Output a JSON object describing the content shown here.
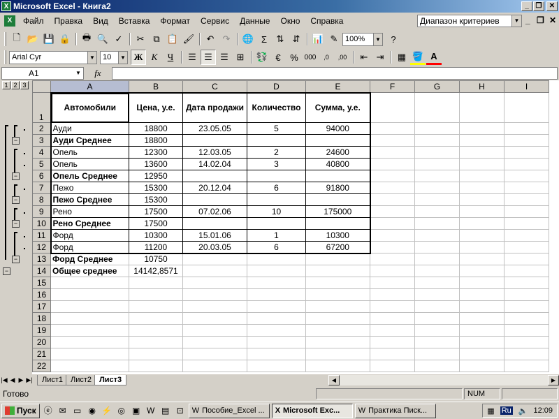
{
  "window": {
    "title": "Microsoft Excel - Книга2",
    "app_icon": "X"
  },
  "menu": {
    "items": [
      "Файл",
      "Правка",
      "Вид",
      "Вставка",
      "Формат",
      "Сервис",
      "Данные",
      "Окно",
      "Справка"
    ],
    "help_box": "Диапазон критериев"
  },
  "toolbar": {
    "zoom": "100%",
    "font_name": "Arial Cyr",
    "font_size": "10",
    "bold_label": "Ж",
    "italic_label": "К",
    "underline_label": "Ч"
  },
  "formula": {
    "name_box": "A1",
    "fx": "fx",
    "content": ""
  },
  "grid": {
    "columns": [
      "A",
      "B",
      "C",
      "D",
      "E",
      "F",
      "G",
      "H",
      "I"
    ],
    "header_row": [
      "Автомобили",
      "Цена, у.е.",
      "Дата продажи",
      "Количество",
      "Сумма, у.е."
    ],
    "rows": [
      {
        "n": "2",
        "cells": [
          "Ауди",
          "18800",
          "23.05.05",
          "5",
          "94000"
        ],
        "bold": false
      },
      {
        "n": "3",
        "cells": [
          "Ауди Среднее",
          "18800",
          "",
          "",
          ""
        ],
        "bold": true
      },
      {
        "n": "4",
        "cells": [
          "Опель",
          "12300",
          "12.03.05",
          "2",
          "24600"
        ],
        "bold": false
      },
      {
        "n": "5",
        "cells": [
          "Опель",
          "13600",
          "14.02.04",
          "3",
          "40800"
        ],
        "bold": false
      },
      {
        "n": "6",
        "cells": [
          "Опель Среднее",
          "12950",
          "",
          "",
          ""
        ],
        "bold": true
      },
      {
        "n": "7",
        "cells": [
          "Пежо",
          "15300",
          "20.12.04",
          "6",
          "91800"
        ],
        "bold": false
      },
      {
        "n": "8",
        "cells": [
          "Пежо Среднее",
          "15300",
          "",
          "",
          ""
        ],
        "bold": true
      },
      {
        "n": "9",
        "cells": [
          "Рено",
          "17500",
          "07.02.06",
          "10",
          "175000"
        ],
        "bold": false
      },
      {
        "n": "10",
        "cells": [
          "Рено Среднее",
          "17500",
          "",
          "",
          ""
        ],
        "bold": true
      },
      {
        "n": "11",
        "cells": [
          "Форд",
          "10300",
          "15.01.06",
          "1",
          "10300"
        ],
        "bold": false
      },
      {
        "n": "12",
        "cells": [
          "Форд",
          "11200",
          "20.03.05",
          "6",
          "67200"
        ],
        "bold": false
      },
      {
        "n": "13",
        "cells": [
          "Форд Среднее",
          "10750",
          "",
          "",
          ""
        ],
        "bold": true
      },
      {
        "n": "14",
        "cells": [
          "Общее среднее",
          "14142,8571",
          "",
          "",
          ""
        ],
        "bold": true
      }
    ],
    "empty_rows": [
      "15",
      "16",
      "17",
      "18",
      "19",
      "20",
      "21",
      "22"
    ]
  },
  "outline": {
    "levels": [
      "1",
      "2",
      "3"
    ]
  },
  "sheets": {
    "tabs": [
      "Лист1",
      "Лист2",
      "Лист3"
    ],
    "active": "Лист3"
  },
  "status": {
    "text": "Готово",
    "num": "NUM"
  },
  "taskbar": {
    "start": "Пуск",
    "tasks": [
      "Пособие_Excel ...",
      "Microsoft Exc...",
      "Практика Писк..."
    ],
    "lang": "Ru",
    "clock": "12:09"
  }
}
